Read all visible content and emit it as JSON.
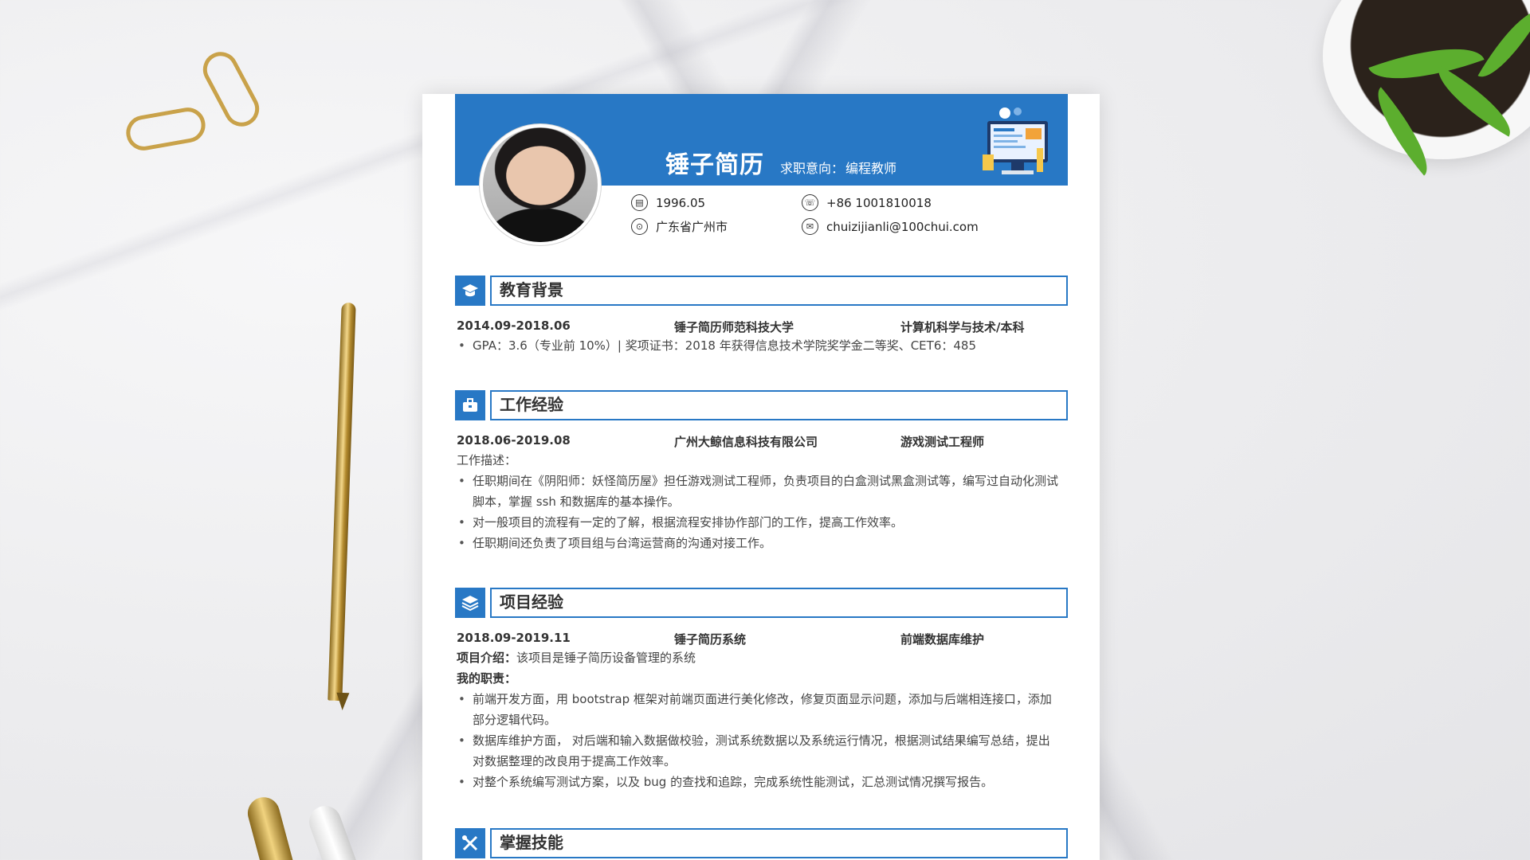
{
  "resume": {
    "name": "锤子简历",
    "intent_label": "求职意向：",
    "intent_value": "编程教师",
    "contacts": {
      "birth": "1996.05",
      "phone": "+86 1001810018",
      "location": "广东省广州市",
      "email": "chuizijianli@100chui.com"
    },
    "sections": {
      "education": {
        "title": "教育背景",
        "date": "2014.09-2018.06",
        "school": "锤子简历师范科技大学",
        "major": "计算机科学与技术/本科",
        "bullets": [
          "GPA：3.6（专业前 10%）| 奖项证书：2018 年获得信息技术学院奖学金二等奖、CET6：485"
        ]
      },
      "work": {
        "title": "工作经验",
        "date": "2018.06-2019.08",
        "company": "广州大鲸信息科技有限公司",
        "role": "游戏测试工程师",
        "desc_label": "工作描述：",
        "bullets": [
          "任职期间在《阴阳师：妖怪简历屋》担任游戏测试工程师，负责项目的白盒测试黑盒测试等，编写过自动化测试",
          "脚本，掌握 ssh 和数据库的基本操作。",
          "对一般项目的流程有一定的了解，根据流程安排协作部门的工作，提高工作效率。",
          "任职期间还负责了项目组与台湾运营商的沟通对接工作。"
        ]
      },
      "project": {
        "title": "项目经验",
        "date": "2018.09-2019.11",
        "name": "锤子简历系统",
        "role": "前端数据库维护",
        "intro_label": "项目介绍：",
        "intro_value": "该项目是锤子简历设备管理的系统",
        "duty_label": "我的职责：",
        "bullets": [
          "前端开发方面，用 bootstrap 框架对前端页面进行美化修改，修复页面显示问题，添加与后端相连接口，添加",
          "部分逻辑代码。",
          "数据库维护方面， 对后端和输入数据做校验，测试系统数据以及系统运行情况，根据测试结果编写总结，提出",
          "对数据整理的改良用于提高工作效率。",
          "对整个系统编写测试方案，以及 bug 的查找和追踪，完成系统性能测试，汇总测试情况撰写报告。"
        ]
      },
      "skills": {
        "title": "掌握技能"
      }
    },
    "colors": {
      "accent": "#2878c5"
    },
    "icons": [
      "calendar-icon",
      "phone-icon",
      "location-icon",
      "email-icon",
      "graduation-cap-icon",
      "briefcase-icon",
      "layers-icon",
      "tools-icon"
    ]
  }
}
